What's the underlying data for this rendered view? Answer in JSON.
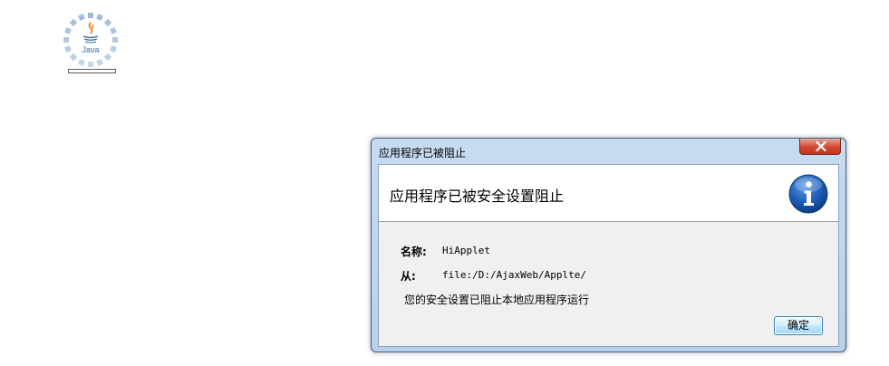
{
  "loader": {
    "logo_text": "Java",
    "progress_fraction": 0.0
  },
  "dialog": {
    "title": "应用程序已被阻止",
    "close_icon": "close-icon",
    "header": "应用程序已被安全设置阻止",
    "header_icon": "info-icon",
    "details": {
      "name_label": "名称:",
      "name_value": "HiApplet",
      "from_label": "从:",
      "from_value": "file:/D:/AjaxWeb/Applte/"
    },
    "message": "您的安全设置已阻止本地应用程序运行",
    "ok_label": "确定"
  },
  "colors": {
    "titlebar": "#c7dbf1",
    "close_button": "#d2462e",
    "info_icon": "#1d5fb5",
    "java_spinner": "#8fb0d6",
    "java_logo": "#e76f00"
  }
}
